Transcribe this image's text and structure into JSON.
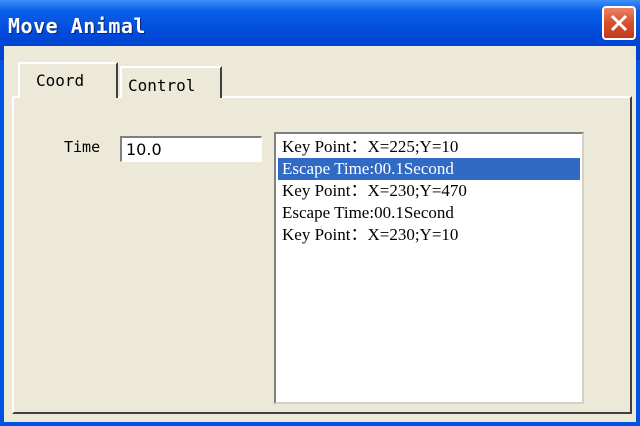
{
  "window": {
    "title": "Move Animal"
  },
  "tabs": [
    {
      "label": "Coord",
      "active": true
    },
    {
      "label": "Control",
      "active": false
    }
  ],
  "time": {
    "label": "Time",
    "value": "10.0"
  },
  "listbox": {
    "items": [
      "Key Point：X=225;Y=10",
      "Escape Time:00.1Second",
      "Key Point：X=230;Y=470",
      "Escape Time:00.1Second",
      "Key Point：X=230;Y=10"
    ],
    "selected_index": 1
  },
  "colors": {
    "title_bar": "#0054e3",
    "selection": "#316ac5",
    "dialog_face": "#ece9d8",
    "close_button": "#d9532f"
  },
  "icons": {
    "close": "close-icon"
  }
}
